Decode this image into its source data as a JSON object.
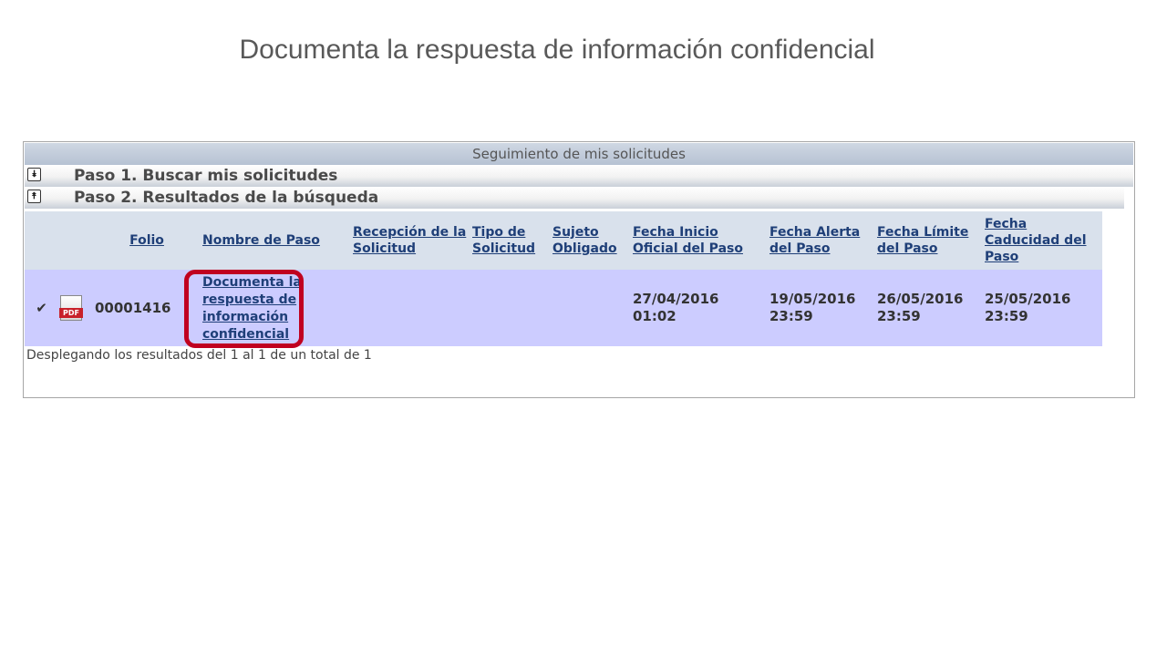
{
  "slide": {
    "title": "Documenta la respuesta de información confidencial"
  },
  "panel": {
    "header": "Seguimiento de mis solicitudes",
    "steps": [
      {
        "label": "Paso 1. Buscar mis solicitudes",
        "toggle": "⌄⌄"
      },
      {
        "label": "Paso 2. Resultados de la búsqueda",
        "toggle": "⌃⌃"
      }
    ]
  },
  "table": {
    "columns": [
      "Folio",
      "Nombre de Paso",
      "Recepción de la Solicitud",
      "Tipo de Solicitud",
      "Sujeto Obligado",
      "Fecha Inicio Oficial del Paso",
      "Fecha Alerta del Paso",
      "Fecha Límite del Paso",
      "Fecha Caducidad del Paso"
    ],
    "rows": [
      {
        "status_icon": "check-icon",
        "file_icon": "pdf-icon",
        "pdf_label": "PDF",
        "folio": "00001416",
        "nombre_paso": "Documenta la respuesta de información confidencial",
        "recepcion": "",
        "tipo": "",
        "sujeto": "",
        "fecha_inicio": "27/04/2016 01:02",
        "fecha_alerta": "19/05/2016 23:59",
        "fecha_limite": "26/05/2016 23:59",
        "fecha_caducidad": "25/05/2016 23:59"
      }
    ]
  },
  "footer": "Desplegando los resultados del 1 al 1 de un total de 1",
  "colors": {
    "row_bg": "#ccccff",
    "header_bg": "#d9e1ec",
    "highlight": "#c00020",
    "check": "#1aa31a"
  }
}
